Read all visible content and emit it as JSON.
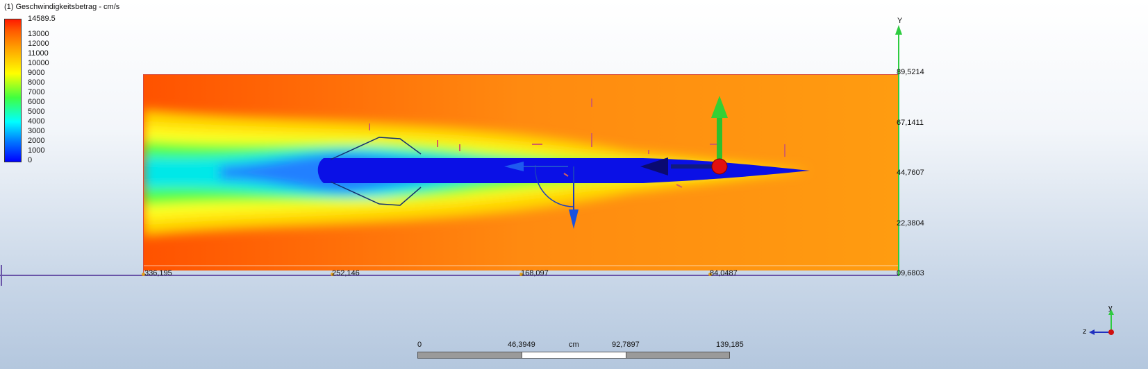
{
  "title": "(1) Geschwindigkeitsbetrag - cm/s",
  "legend": {
    "max": "14589.5",
    "labels": [
      "13000",
      "12000",
      "11000",
      "10000",
      "9000",
      "8000",
      "7000",
      "6000",
      "5000",
      "4000",
      "3000",
      "2000",
      "1000",
      "0"
    ]
  },
  "axis_y": {
    "label": "Y",
    "ticks": [
      "89,5214",
      "67,1411",
      "44,7607",
      "22,3804",
      "09,6803"
    ]
  },
  "axis_x": {
    "ticks": [
      "336,195",
      "252,146",
      "168,097",
      "84,0487"
    ]
  },
  "scale": {
    "labels": [
      "0",
      "46,3949",
      "cm",
      "92,7897",
      "139,185"
    ]
  },
  "triad": {
    "y_label": "y",
    "z_label": "z"
  },
  "colors": {
    "frame": "#d64a3a",
    "axis_y": "#2ecc40",
    "axis_x": "#6a55a8"
  }
}
